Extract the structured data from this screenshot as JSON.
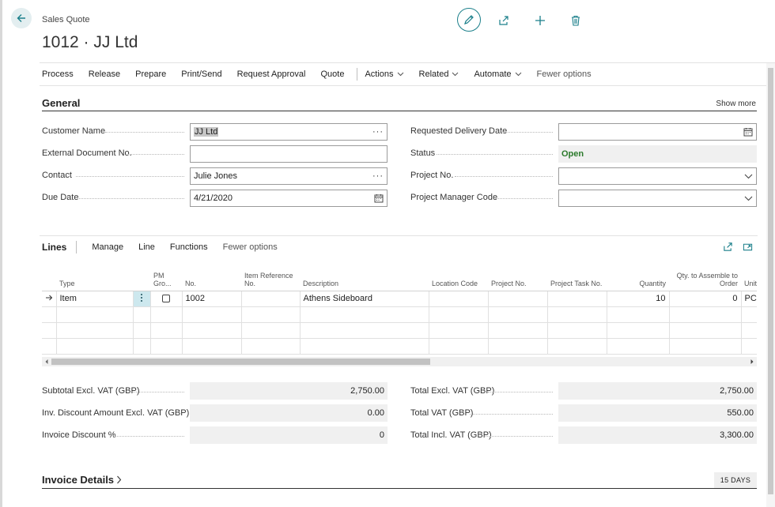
{
  "header": {
    "caption": "Sales Quote",
    "title": "1012 · JJ Ltd"
  },
  "icons": {
    "back": "arrow-left-icon",
    "edit": "pencil-icon",
    "share": "share-icon",
    "new": "plus-icon",
    "delete": "trash-icon"
  },
  "actions": [
    {
      "label": "Process"
    },
    {
      "label": "Release"
    },
    {
      "label": "Prepare"
    },
    {
      "label": "Print/Send"
    },
    {
      "label": "Request Approval"
    },
    {
      "label": "Quote"
    },
    {
      "label": "Actions",
      "dropdown": true
    },
    {
      "label": "Related",
      "dropdown": true
    },
    {
      "label": "Automate",
      "dropdown": true
    },
    {
      "label": "Fewer options"
    }
  ],
  "general": {
    "title": "General",
    "show_more": "Show more",
    "customer_name": {
      "label": "Customer Name",
      "value": "JJ Ltd"
    },
    "external_doc": {
      "label": "External Document No.",
      "value": ""
    },
    "contact": {
      "label": "Contact",
      "value": "Julie Jones"
    },
    "due_date": {
      "label": "Due Date",
      "value": "4/21/2020"
    },
    "req_delivery": {
      "label": "Requested Delivery Date",
      "value": ""
    },
    "status": {
      "label": "Status",
      "value": "Open"
    },
    "project_no": {
      "label": "Project No.",
      "value": ""
    },
    "project_manager": {
      "label": "Project Manager Code",
      "value": ""
    }
  },
  "lines": {
    "title": "Lines",
    "menu": [
      "Manage",
      "Line",
      "Functions",
      "Fewer options"
    ],
    "columns": {
      "type": "Type",
      "pm_group": "PM Gro...",
      "no": "No.",
      "item_ref": "Item Reference No.",
      "description": "Description",
      "location": "Location Code",
      "project_no": "Project No.",
      "project_task": "Project Task No.",
      "quantity": "Quantity",
      "qty_assemble": "Qty. to Assemble to Order",
      "unit": "Unit Meas..."
    },
    "rows": [
      {
        "type": "Item",
        "no": "1002",
        "item_ref": "",
        "description": "Athens Sideboard",
        "location": "",
        "project_no": "",
        "project_task": "",
        "quantity": "10",
        "qty_assemble": "0",
        "unit": "PCS"
      }
    ]
  },
  "totals": {
    "subtotal": {
      "label": "Subtotal Excl. VAT (GBP)",
      "value": "2,750.00"
    },
    "inv_discount_amount": {
      "label": "Inv. Discount Amount Excl. VAT (GBP)",
      "value": "0.00"
    },
    "invoice_discount_pct": {
      "label": "Invoice Discount %",
      "value": "0"
    },
    "total_excl": {
      "label": "Total Excl. VAT (GBP)",
      "value": "2,750.00"
    },
    "total_vat": {
      "label": "Total VAT (GBP)",
      "value": "550.00"
    },
    "total_incl": {
      "label": "Total Incl. VAT (GBP)",
      "value": "3,300.00"
    }
  },
  "invoice_details": {
    "title": "Invoice Details",
    "badge": "15 DAYS"
  },
  "colors": {
    "accent": "#1a7f8a",
    "status_open": "#2b7a2b",
    "selected_cell": "#cde8ee"
  }
}
